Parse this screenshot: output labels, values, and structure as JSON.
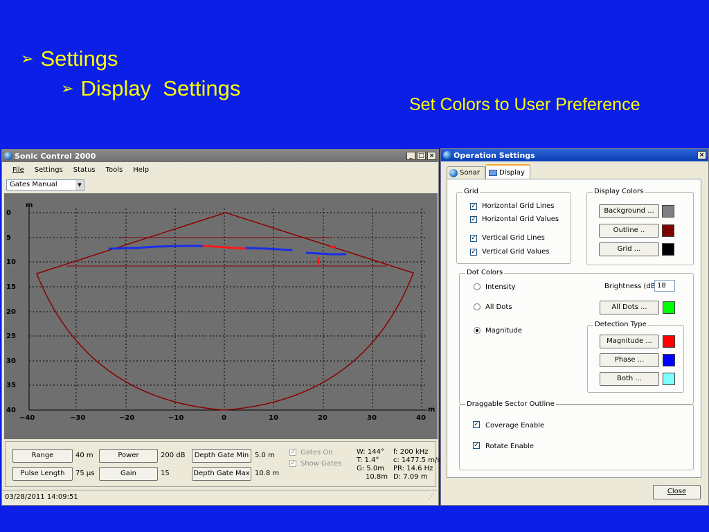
{
  "slide": {
    "heading1": "Settings",
    "heading2": "Display  Settings",
    "note": "Set Colors to User Preference",
    "bullet_glyph": "➢"
  },
  "sonic_window": {
    "title": "Sonic Control 2000",
    "title_buttons": [
      "_",
      "□",
      "×"
    ],
    "menu": [
      "File",
      "Settings",
      "Status",
      "Tools",
      "Help"
    ],
    "mode_select": "Gates Manual",
    "plot": {
      "unit": "m",
      "y_ticks": [
        "0",
        "5",
        "10",
        "15",
        "20",
        "25",
        "30",
        "35",
        "40"
      ],
      "x_ticks": [
        "−40",
        "−30",
        "−20",
        "−10",
        "0",
        "10",
        "20",
        "30",
        "40"
      ],
      "x_unit": "m"
    },
    "controls": {
      "range_label": "Range",
      "range_value": "40 m",
      "power_label": "Power",
      "power_value": "200 dB",
      "dgmin_label": "Depth Gate Min",
      "dgmin_value": "5.0 m",
      "pulse_label": "Pulse Length",
      "pulse_value": "75 µs",
      "gain_label": "Gain",
      "gain_value": "15",
      "dgmax_label": "Depth Gate Max",
      "dgmax_value": "10.8 m",
      "gates_on": "Gates On",
      "show_gates": "Show Gates"
    },
    "status": {
      "w": "W: 144°",
      "t": "T: 1.4°",
      "g": "G: 5.0m",
      "g2": "10.8m",
      "f": "f: 200 kHz",
      "c": "c: 1477.5 m/s",
      "pr": "PR: 14.6 Hz",
      "d": "D: 7.09 m"
    },
    "timestamp": "03/28/2011 14:09:51"
  },
  "settings_window": {
    "title": "Operation Settings",
    "close_x": "×",
    "tabs": [
      "Sonar",
      "Display"
    ],
    "grid_group": "Grid",
    "grid_items": [
      "Horizontal Grid Lines",
      "Horizontal Grid Values",
      "Vertical Grid Lines",
      "Vertical Grid Values"
    ],
    "display_colors_group": "Display Colors",
    "background_btn": "Background ...",
    "outline_btn": "Outline ..",
    "grid_btn": "Grid ...",
    "dot_colors_group": "Dot Colors",
    "intensity": "Intensity",
    "all_dots": "All Dots",
    "magnitude": "Magnitude",
    "brightness_label": "Brightness (dB)",
    "brightness_value": "18",
    "all_dots_btn": "All Dots ...",
    "detection_group": "Detection Type",
    "magnitude_btn": "Magnitude ...",
    "phase_btn": "Phase ...",
    "both_btn": "Both ...",
    "sector_group": "Draggable Sector Outline",
    "coverage": "Coverage Enable",
    "rotate": "Rotate Enable",
    "close_btn": "Close",
    "colors": {
      "background": "#808080",
      "outline": "#800000",
      "grid": "#000000",
      "all_dots": "#00ff00",
      "magnitude": "#ff0000",
      "phase": "#0000ff",
      "both": "#80ffff"
    }
  }
}
